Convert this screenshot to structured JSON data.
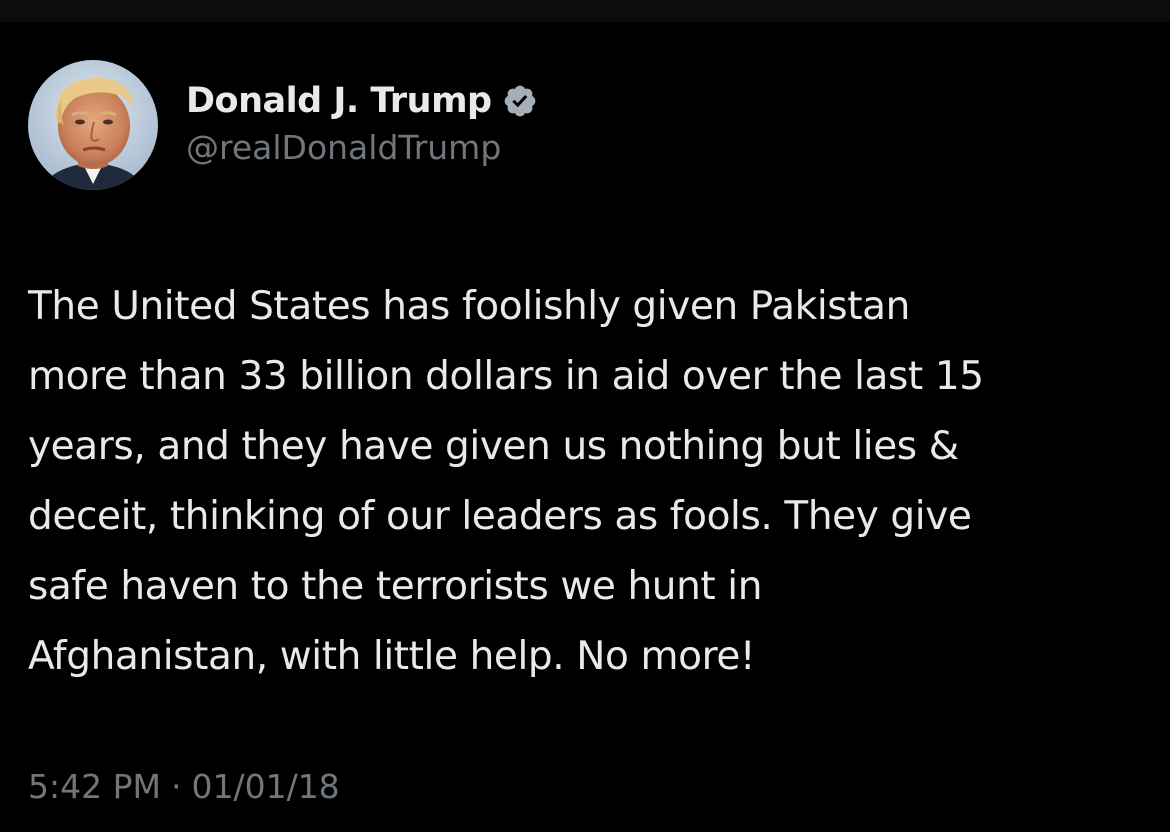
{
  "author": {
    "display_name": "Donald J. Trump",
    "handle": "@realDonaldTrump",
    "verified_icon": "verified-badge-icon",
    "avatar": "profile-photo"
  },
  "tweet": {
    "lines": [
      "The United States has foolishly given Pakistan",
      "more than 33 billion dollars in aid over the last 15",
      "years, and they have given us nothing but lies &",
      "deceit, thinking of our leaders as fools. They give",
      "safe haven to the terrorists we hunt in",
      "Afghanistan, with little help. No more!"
    ]
  },
  "meta": {
    "time": "5:42 PM",
    "separator": "·",
    "date": "01/01/18"
  },
  "colors": {
    "background": "#000000",
    "text_primary": "#e7e9ea",
    "text_secondary": "#71767b",
    "badge": "#a6aeb6"
  }
}
